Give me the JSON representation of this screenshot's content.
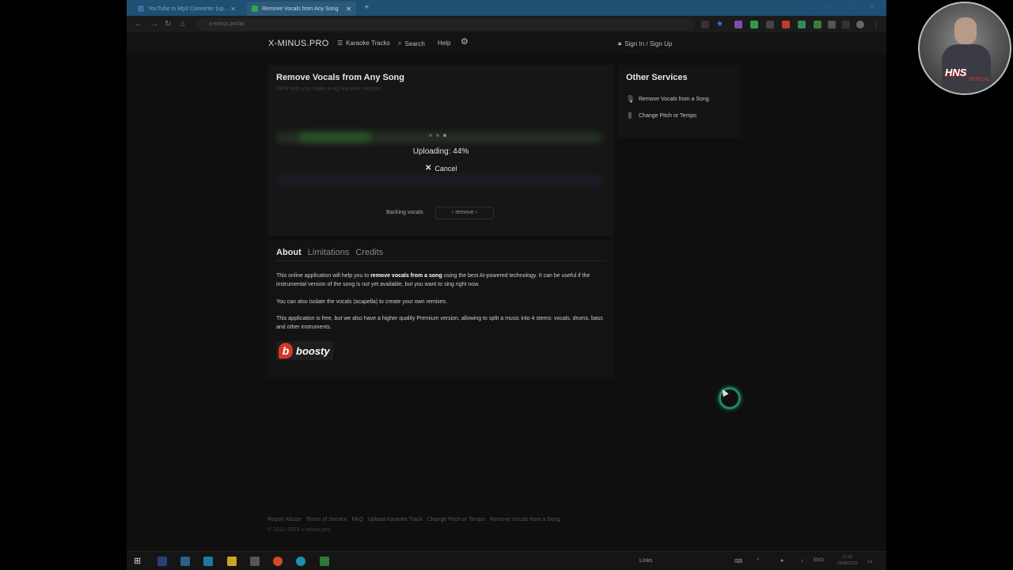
{
  "browser": {
    "tabs": [
      {
        "label": "YouTube to Mp3 Converter (up...",
        "active": false
      },
      {
        "label": "Remove Vocals from Any Song",
        "active": true
      }
    ],
    "url": "x-minus.pro/ai"
  },
  "site": {
    "logo": "X-MINUS.PRO",
    "nav": {
      "karaoke": "Karaoke Tracks",
      "search": "Search",
      "help": "Help",
      "signin": "Sign In / Sign Up"
    }
  },
  "main": {
    "title": "Remove Vocals from Any Song",
    "subtitle": "We'll help you make a HQ karaoke version!",
    "upload_status": "Uploading: 44%",
    "upload_progress": 0.44,
    "cancel_label": "Cancel",
    "backing_label": "Backing vocals",
    "backing_option": "‹ remove ›"
  },
  "info": {
    "tabs": [
      "About",
      "Limitations",
      "Credits"
    ],
    "p1_pre": "This online application will help you to ",
    "p1_bold": "remove vocals from a song",
    "p1_post": " using the best AI-powered technology. It can be useful if the instrumental version of the song is not yet available, but you want to sing right now.",
    "p2": "You can also isolate the vocals (acapella) to create your own remixes.",
    "p3": "This application is free, but we also have a higher quality Premium version, allowing to split a music into 4 stems: vocals, drums, bass and other instruments.",
    "boosty": "boosty",
    "boosty_mark": "b"
  },
  "sidebar": {
    "title": "Other Services",
    "items": [
      {
        "label": "Remove Vocals from a Song",
        "icon": "microphone-off-icon"
      },
      {
        "label": "Change Pitch or Tempo",
        "icon": "sliders-icon"
      }
    ]
  },
  "footer": {
    "links": [
      "Report Abuse",
      "Terms of Service",
      "FAQ",
      "Upload Karaoke Track",
      "Change Pitch or Tempo",
      "Remove Vocals from a Song"
    ],
    "copyright": "© 2012-2023 x-minus.pro"
  },
  "taskbar": {
    "links": "Links",
    "lang": "ENG",
    "time": "17:18",
    "date": "25/05/2023"
  },
  "overlay": {
    "badge": "HNS",
    "badge_sub": "OFFICIAL"
  },
  "colors": {
    "accent_spinner": "#1c8a6a",
    "boosty_brand": "#d3372a",
    "tabstrip": "#1f4f73"
  }
}
